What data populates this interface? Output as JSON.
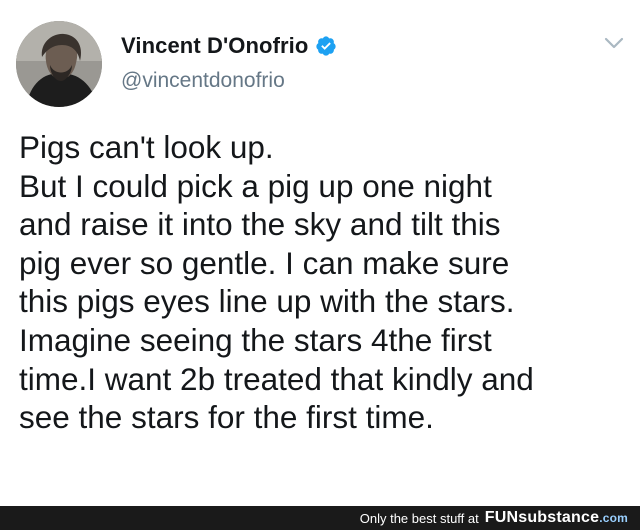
{
  "tweet": {
    "display_name": "Vincent D'Onofrio",
    "verified_icon": "verified-check-icon",
    "handle": "@vincentdonofrio",
    "menu_icon": "chevron-down-icon",
    "text": "Pigs can't look up.\nBut I could pick a pig up one night\nand raise it into the sky and tilt this\npig ever so gentle. I can make sure\nthis pigs eyes line up with the stars.\nImagine seeing the stars 4the first\ntime.I want 2b treated that kindly and\nsee the stars for the first time."
  },
  "watermark": {
    "tagline": "Only the best stuff at",
    "brand_part1": "FUN",
    "brand_part2": "substance",
    "brand_part3": ".com"
  },
  "colors": {
    "verified_blue": "#1da1f2",
    "handle_gray": "#657786",
    "text_dark": "#14171a",
    "footer_bg": "#1a1a1a"
  }
}
